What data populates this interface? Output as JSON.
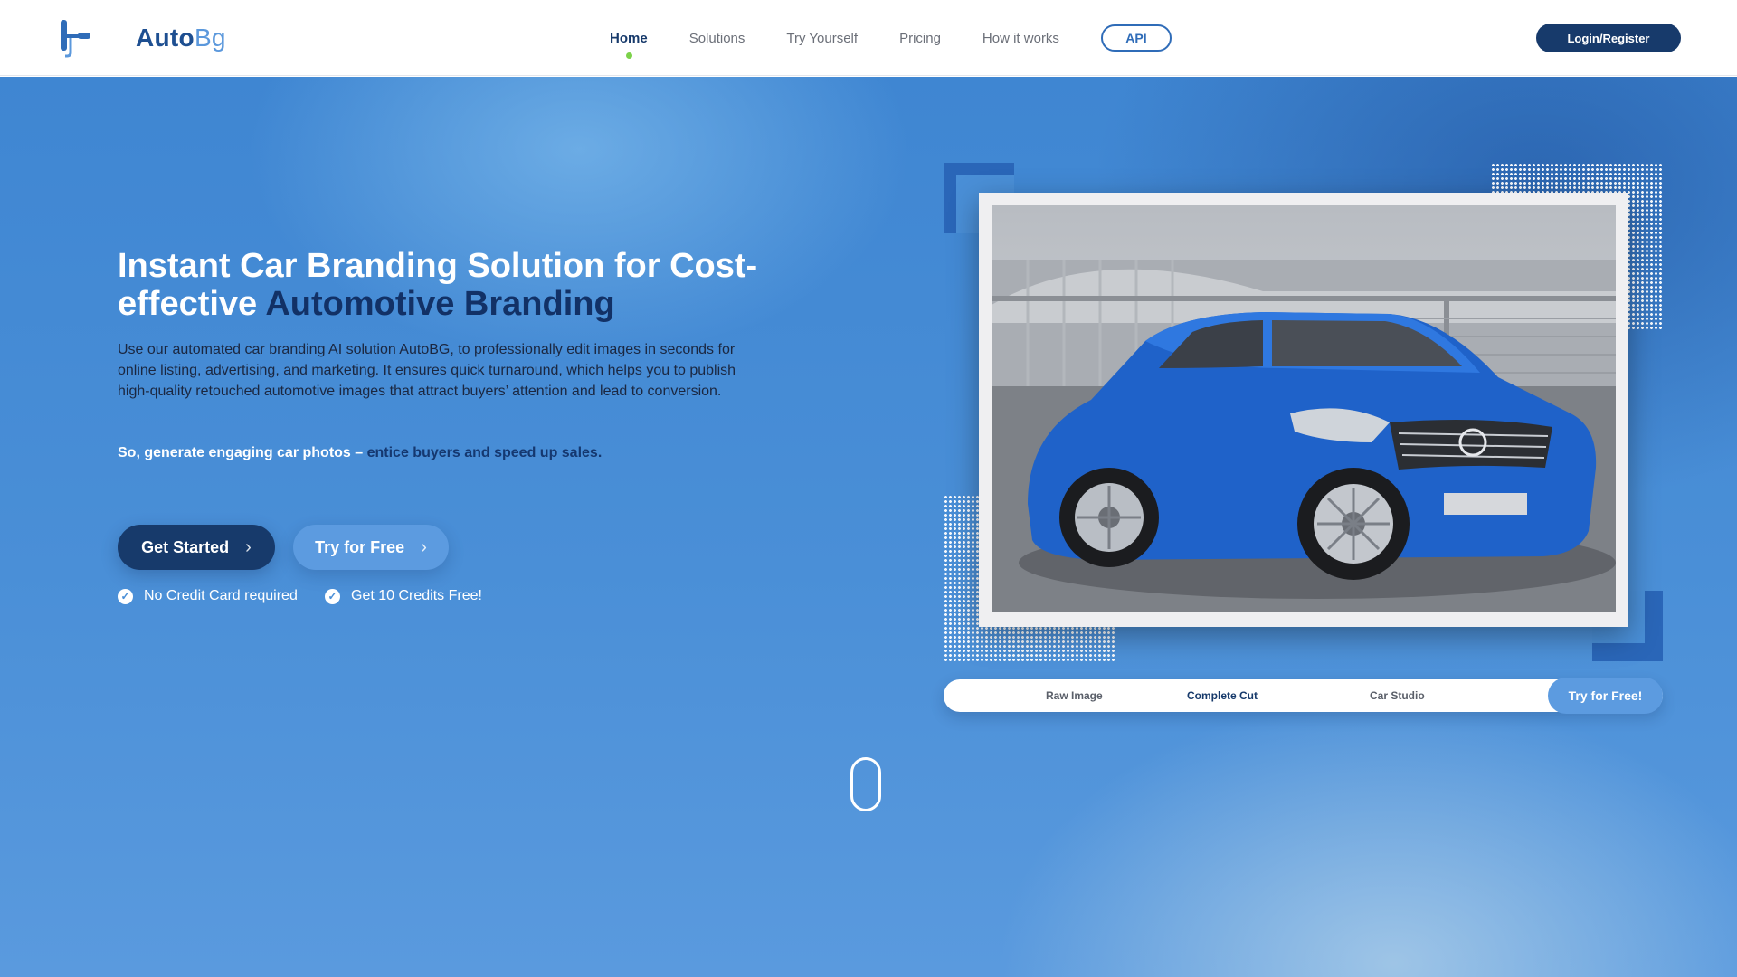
{
  "brand": {
    "name_main": "Auto",
    "name_accent": "Bg"
  },
  "nav": {
    "items": [
      {
        "label": "Home",
        "active": true
      },
      {
        "label": "Solutions",
        "active": false
      },
      {
        "label": "Try Yourself",
        "active": false
      },
      {
        "label": "Pricing",
        "active": false
      },
      {
        "label": "How it works",
        "active": false
      }
    ],
    "api_label": "API",
    "login_label": "Login/Register"
  },
  "hero": {
    "headline_part1": "Instant Car Branding Solution for Cost-effective ",
    "headline_part2": "Automotive Branding",
    "description": "Use our automated car branding AI solution AutoBG, to professionally edit images in seconds for online listing, advertising, and marketing. It ensures quick turnaround, which helps you to publish high-quality retouched automotive images that attract buyers’ attention and lead to conversion.",
    "tagline_part1": "So, generate engaging car photos – ",
    "tagline_part2": "entice buyers and speed up sales.",
    "primary_cta": "Get Started",
    "secondary_cta": "Try for Free",
    "perks": [
      "No Credit Card required",
      "Get 10 Credits Free!"
    ]
  },
  "showcase": {
    "tabs": [
      {
        "label": "Raw Image",
        "active": false
      },
      {
        "label": "Complete Cut",
        "active": true
      },
      {
        "label": "Car Studio",
        "active": false
      }
    ],
    "cta_label": "Try for Free!"
  },
  "colors": {
    "brand_dark": "#173a6b",
    "brand_light": "#5c9be0",
    "accent_green": "#7cd24a",
    "hero_blue": "#4a8fd7"
  },
  "icons": {
    "logo": "paint-roller-logo-icon",
    "chevron": "chevron-right-icon",
    "check": "check-circle-icon",
    "scroll": "scroll-mouse-icon"
  }
}
